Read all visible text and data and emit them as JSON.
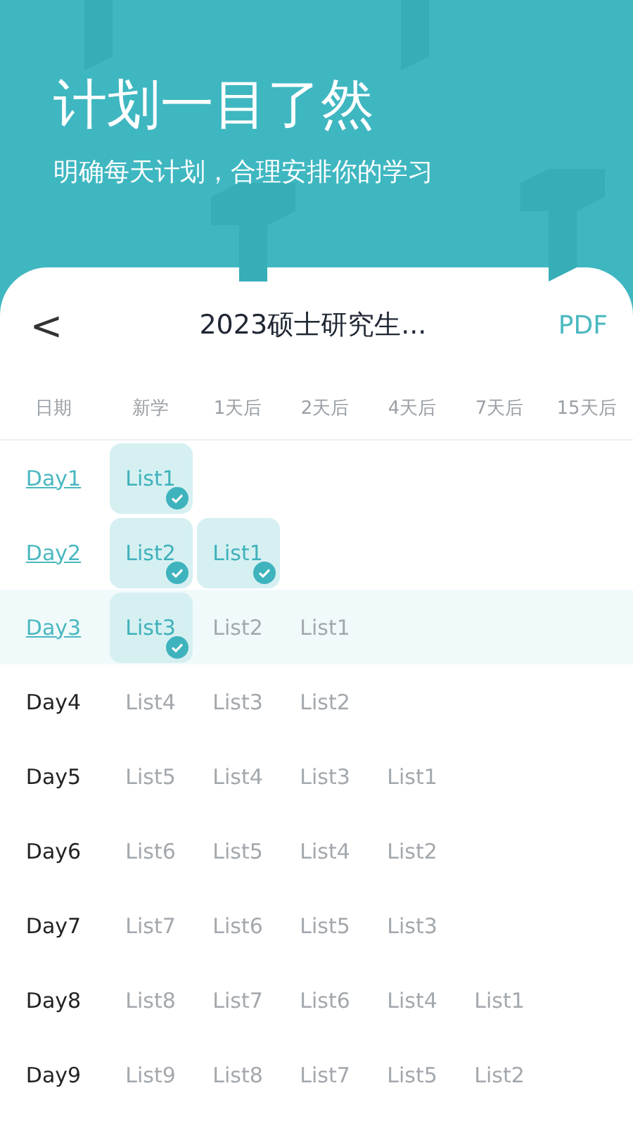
{
  "hero": {
    "title": "计划一目了然",
    "subtitle": "明确每天计划，合理安排你的学习"
  },
  "nav": {
    "back": "<",
    "title": "2023硕士研究生...",
    "action": "PDF"
  },
  "columns": [
    "日期",
    "新学",
    "1天后",
    "2天后",
    "4天后",
    "7天后",
    "15天后"
  ],
  "rows": [
    {
      "day": "Day1",
      "done": true,
      "selected": false,
      "cells": [
        {
          "text": "List1",
          "checked": true
        }
      ]
    },
    {
      "day": "Day2",
      "done": true,
      "selected": false,
      "cells": [
        {
          "text": "List2",
          "checked": true
        },
        {
          "text": "List1",
          "checked": true
        }
      ]
    },
    {
      "day": "Day3",
      "done": true,
      "selected": true,
      "cells": [
        {
          "text": "List3",
          "checked": true
        },
        {
          "text": "List2",
          "checked": false
        },
        {
          "text": "List1",
          "checked": false
        }
      ]
    },
    {
      "day": "Day4",
      "done": false,
      "selected": false,
      "cells": [
        {
          "text": "List4",
          "checked": false
        },
        {
          "text": "List3",
          "checked": false
        },
        {
          "text": "List2",
          "checked": false
        }
      ]
    },
    {
      "day": "Day5",
      "done": false,
      "selected": false,
      "cells": [
        {
          "text": "List5",
          "checked": false
        },
        {
          "text": "List4",
          "checked": false
        },
        {
          "text": "List3",
          "checked": false
        },
        {
          "text": "List1",
          "checked": false
        }
      ]
    },
    {
      "day": "Day6",
      "done": false,
      "selected": false,
      "cells": [
        {
          "text": "List6",
          "checked": false
        },
        {
          "text": "List5",
          "checked": false
        },
        {
          "text": "List4",
          "checked": false
        },
        {
          "text": "List2",
          "checked": false
        }
      ]
    },
    {
      "day": "Day7",
      "done": false,
      "selected": false,
      "cells": [
        {
          "text": "List7",
          "checked": false
        },
        {
          "text": "List6",
          "checked": false
        },
        {
          "text": "List5",
          "checked": false
        },
        {
          "text": "List3",
          "checked": false
        }
      ]
    },
    {
      "day": "Day8",
      "done": false,
      "selected": false,
      "cells": [
        {
          "text": "List8",
          "checked": false
        },
        {
          "text": "List7",
          "checked": false
        },
        {
          "text": "List6",
          "checked": false
        },
        {
          "text": "List4",
          "checked": false
        },
        {
          "text": "List1",
          "checked": false
        }
      ]
    },
    {
      "day": "Day9",
      "done": false,
      "selected": false,
      "cells": [
        {
          "text": "List9",
          "checked": false
        },
        {
          "text": "List8",
          "checked": false
        },
        {
          "text": "List7",
          "checked": false
        },
        {
          "text": "List5",
          "checked": false
        },
        {
          "text": "List2",
          "checked": false
        }
      ]
    }
  ]
}
